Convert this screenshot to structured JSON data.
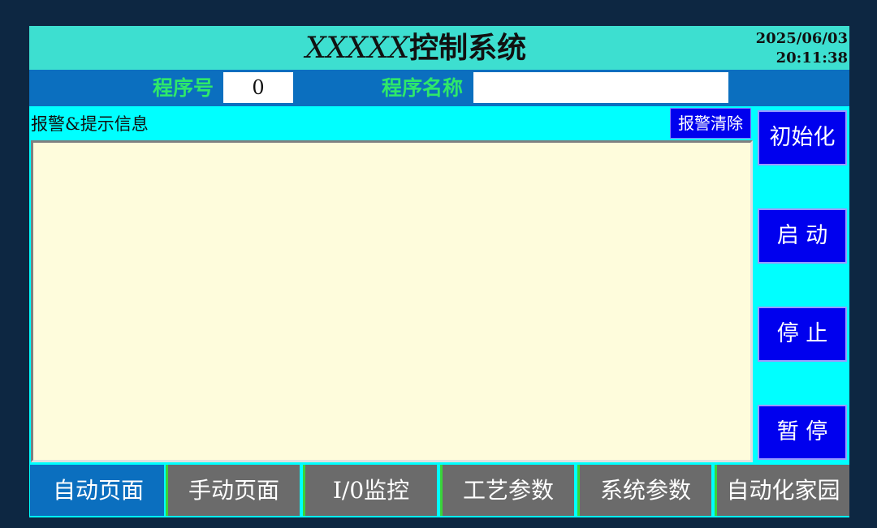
{
  "header": {
    "title_prefix": "XXXXX",
    "title_suffix": "控制系统",
    "date": "2025/06/03",
    "time": "20:11:38"
  },
  "info_bar": {
    "program_no_label": "程序号",
    "program_no_value": "0",
    "program_name_label": "程序名称",
    "program_name_value": ""
  },
  "alarm": {
    "header_label": "报警&提示信息",
    "clear_label": "报警清除"
  },
  "side_buttons": {
    "init": "初始化",
    "start": "启 动",
    "stop": "停 止",
    "pause": "暂 停"
  },
  "tabs": [
    {
      "label": "自动页面",
      "active": true
    },
    {
      "label": "手动页面",
      "active": false
    },
    {
      "label": "I/0监控",
      "active": false
    },
    {
      "label": "工艺参数",
      "active": false
    },
    {
      "label": "系统参数",
      "active": false
    },
    {
      "label": "自动化家园",
      "active": false
    }
  ],
  "colors": {
    "screen_bg": "#00ffff",
    "title_bar": "#3ddfd0",
    "info_bar": "#0b6fbf",
    "label_green": "#2ee86a",
    "button_blue": "#0000ee",
    "alarm_bg": "#fefcdc",
    "tab_gray": "#6b6b6b"
  }
}
